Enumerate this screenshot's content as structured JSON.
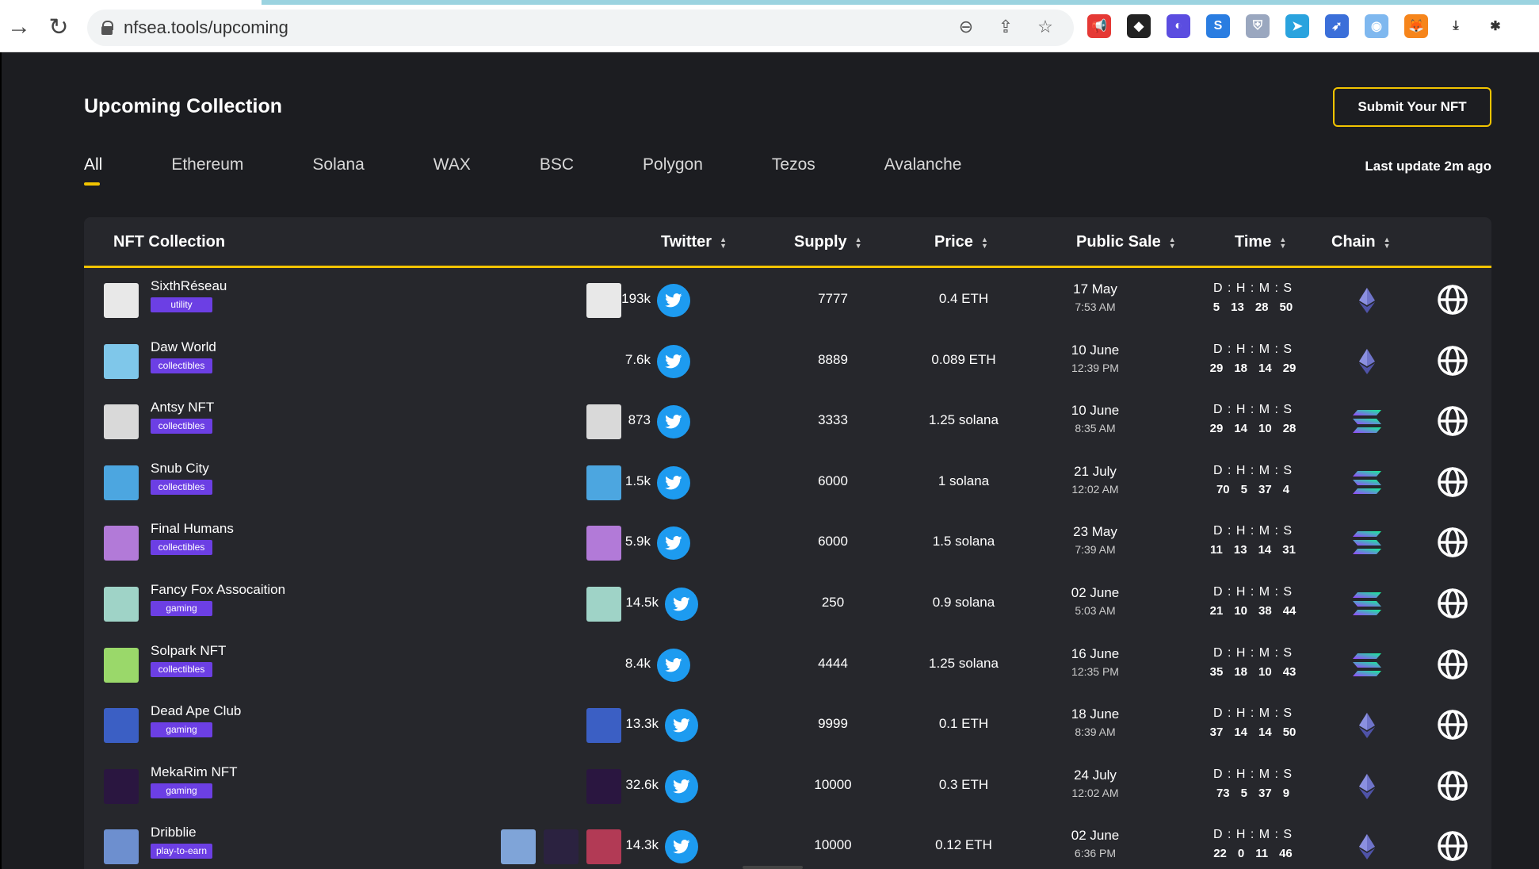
{
  "browser": {
    "url": "nfsea.tools/upcoming",
    "extensions": [
      {
        "icon": "megaphone-icon",
        "color": "#e53935",
        "glyph": "📢"
      },
      {
        "icon": "binance-icon",
        "color": "#222222",
        "glyph": "◆"
      },
      {
        "icon": "cursor-ext-icon",
        "color": "#5b4de0",
        "glyph": "◐"
      },
      {
        "icon": "s-ext-icon",
        "color": "#2a7de1",
        "glyph": "S"
      },
      {
        "icon": "shield-ext-icon",
        "color": "#9aa7bf",
        "glyph": "⛨"
      },
      {
        "icon": "telegram-icon",
        "color": "#2aa3de",
        "glyph": "➤"
      },
      {
        "icon": "arrow-ext-icon",
        "color": "#3b6fd9",
        "glyph": "➶"
      },
      {
        "icon": "wallet-ext-icon",
        "color": "#7fb8ef",
        "glyph": "◉"
      },
      {
        "icon": "metamask-icon",
        "color": "#f6851b",
        "glyph": "🦊"
      },
      {
        "icon": "download-icon",
        "color": "#ffffff",
        "glyph": "⤓"
      },
      {
        "icon": "puzzle-icon",
        "color": "#ffffff",
        "glyph": "✱"
      }
    ]
  },
  "page": {
    "title": "Upcoming Collection",
    "submit_label": "Submit Your NFT",
    "last_update": "Last update 2m ago",
    "tabs": [
      "All",
      "Ethereum",
      "Solana",
      "WAX",
      "BSC",
      "Polygon",
      "Tezos",
      "Avalanche"
    ],
    "active_tab": "All"
  },
  "table": {
    "headers": {
      "collection": "NFT Collection",
      "twitter": "Twitter",
      "supply": "Supply",
      "price": "Price",
      "public_sale": "Public Sale",
      "time": "Time",
      "chain": "Chain"
    },
    "countdown_label": "D : H : M : S",
    "rows": [
      {
        "name": "SixthRéseau",
        "tag": "utility",
        "twitter": "193k",
        "supply": "7777",
        "price": "0.4 ETH",
        "date": "17 May",
        "time": "7:53 AM",
        "d": "5",
        "h": "13",
        "m": "28",
        "s": "50",
        "chain": "ethereum",
        "thumb": "#e8e8e8",
        "side_thumbs": [
          "#e8e8e8"
        ]
      },
      {
        "name": "Daw World",
        "tag": "collectibles",
        "twitter": "7.6k",
        "supply": "8889",
        "price": "0.089 ETH",
        "date": "10 June",
        "time": "12:39 PM",
        "d": "29",
        "h": "18",
        "m": "14",
        "s": "29",
        "chain": "ethereum",
        "thumb": "#7fc7ea",
        "side_thumbs": []
      },
      {
        "name": "Antsy NFT",
        "tag": "collectibles",
        "twitter": "873",
        "supply": "3333",
        "price": "1.25 solana",
        "date": "10 June",
        "time": "8:35 AM",
        "d": "29",
        "h": "14",
        "m": "10",
        "s": "28",
        "chain": "solana",
        "thumb": "#d9d9d9",
        "side_thumbs": [
          "#d9d9d9"
        ]
      },
      {
        "name": "Snub City",
        "tag": "collectibles",
        "twitter": "1.5k",
        "supply": "6000",
        "price": "1 solana",
        "date": "21 July",
        "time": "12:02 AM",
        "d": "70",
        "h": "5",
        "m": "37",
        "s": "4",
        "chain": "solana",
        "thumb": "#4ca6e0",
        "side_thumbs": [
          "#4ca6e0"
        ]
      },
      {
        "name": "Final Humans",
        "tag": "collectibles",
        "twitter": "5.9k",
        "supply": "6000",
        "price": "1.5 solana",
        "date": "23 May",
        "time": "7:39 AM",
        "d": "11",
        "h": "13",
        "m": "14",
        "s": "31",
        "chain": "solana",
        "thumb": "#b27ad8",
        "side_thumbs": [
          "#b27ad8"
        ]
      },
      {
        "name": "Fancy Fox Assocaition",
        "tag": "gaming",
        "twitter": "14.5k",
        "supply": "250",
        "price": "0.9 solana",
        "date": "02 June",
        "time": "5:03 AM",
        "d": "21",
        "h": "10",
        "m": "38",
        "s": "44",
        "chain": "solana",
        "thumb": "#9fd3c7",
        "side_thumbs": [
          "#9fd3c7"
        ]
      },
      {
        "name": "Solpark NFT",
        "tag": "collectibles",
        "twitter": "8.4k",
        "supply": "4444",
        "price": "1.25 solana",
        "date": "16 June",
        "time": "12:35 PM",
        "d": "35",
        "h": "18",
        "m": "10",
        "s": "43",
        "chain": "solana",
        "thumb": "#9ad86a",
        "side_thumbs": []
      },
      {
        "name": "Dead Ape Club",
        "tag": "gaming",
        "twitter": "13.3k",
        "supply": "9999",
        "price": "0.1 ETH",
        "date": "18 June",
        "time": "8:39 AM",
        "d": "37",
        "h": "14",
        "m": "14",
        "s": "50",
        "chain": "ethereum",
        "thumb": "#3b5fc4",
        "side_thumbs": [
          "#3b5fc4"
        ]
      },
      {
        "name": "MekaRim NFT",
        "tag": "gaming",
        "twitter": "32.6k",
        "supply": "10000",
        "price": "0.3 ETH",
        "date": "24 July",
        "time": "12:02 AM",
        "d": "73",
        "h": "5",
        "m": "37",
        "s": "9",
        "chain": "ethereum",
        "thumb": "#2a1640",
        "side_thumbs": [
          "#2a1640"
        ]
      },
      {
        "name": "Dribblie",
        "tag": "play-to-earn",
        "twitter": "14.3k",
        "supply": "10000",
        "price": "0.12 ETH",
        "date": "02 June",
        "time": "6:36 PM",
        "d": "22",
        "h": "0",
        "m": "11",
        "s": "46",
        "chain": "ethereum",
        "thumb": "#6d8fcf",
        "side_thumbs": [
          "#7fa4d8",
          "#2b2240",
          "#b23a55"
        ]
      }
    ]
  }
}
